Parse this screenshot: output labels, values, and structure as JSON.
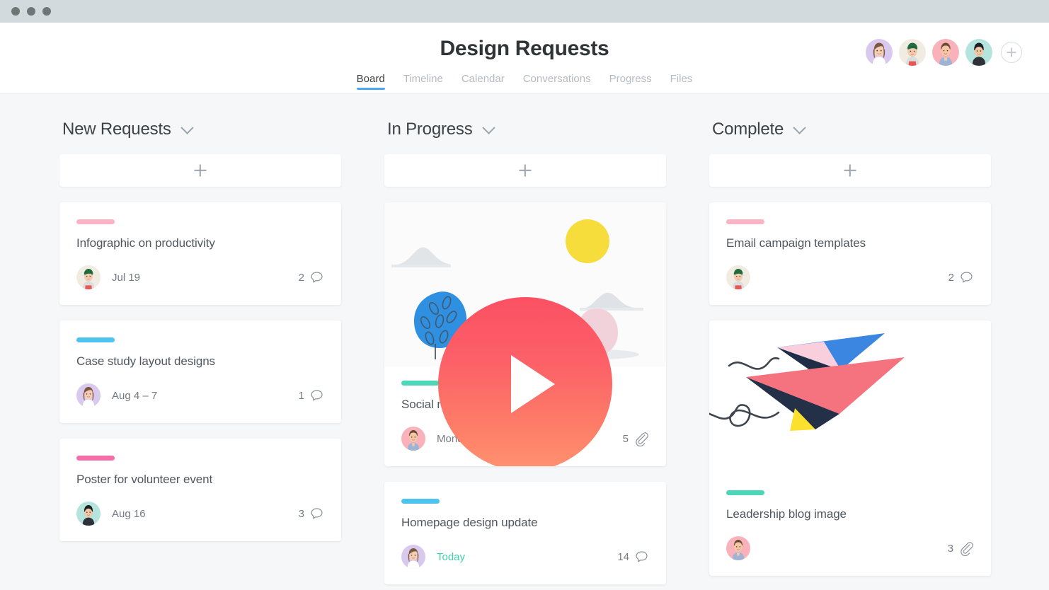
{
  "window": {
    "dots": [
      "close",
      "minimize",
      "maximize"
    ]
  },
  "header": {
    "title": "Design Requests",
    "tabs": [
      {
        "label": "Board",
        "active": true
      },
      {
        "label": "Timeline",
        "active": false
      },
      {
        "label": "Calendar",
        "active": false
      },
      {
        "label": "Conversations",
        "active": false
      },
      {
        "label": "Progress",
        "active": false
      },
      {
        "label": "Files",
        "active": false
      }
    ],
    "members": [
      {
        "name": "member-1",
        "bg": "#d9c9ef"
      },
      {
        "name": "member-2",
        "bg": "#f0ece2"
      },
      {
        "name": "member-3",
        "bg": "#f9b2ba"
      },
      {
        "name": "member-4",
        "bg": "#b5e3dd"
      }
    ],
    "add_member_icon": "plus-icon"
  },
  "colors": {
    "tag_light_pink": "#fab4c4",
    "tag_blue": "#4ec3f0",
    "tag_hot_pink": "#f56ea8",
    "tag_teal": "#4ed6b8",
    "accent_blue": "#4aa8f0",
    "today_green": "#3ecfab",
    "board_bg": "#f6f7f9",
    "titlebar_bg": "#d3dadd"
  },
  "board": {
    "columns": [
      {
        "title": "New Requests",
        "add_label": "add-card",
        "cards": [
          {
            "tag_color": "#fab4c4",
            "title": "Infographic on productivity",
            "date": "Jul 19",
            "date_highlight": false,
            "avatar_bg": "#f0ece2",
            "avatar_kind": "member-2",
            "meta_count": "2",
            "meta_icon": "comment-icon"
          },
          {
            "tag_color": "#4ec3f0",
            "title": "Case study layout designs",
            "date": "Aug 4 – 7",
            "date_highlight": false,
            "avatar_bg": "#d9c9ef",
            "avatar_kind": "member-1",
            "meta_count": "1",
            "meta_icon": "comment-icon"
          },
          {
            "tag_color": "#f56ea8",
            "title": "Poster for volunteer event",
            "date": "Aug 16",
            "date_highlight": false,
            "avatar_bg": "#b5e3dd",
            "avatar_kind": "member-4",
            "meta_count": "3",
            "meta_icon": "comment-icon"
          }
        ]
      },
      {
        "title": "In Progress",
        "add_label": "add-card",
        "cards": [
          {
            "tag_color": "#4ed6b8",
            "title": "Social media assets",
            "date": "Monday",
            "date_highlight": false,
            "avatar_bg": "#f9b2ba",
            "avatar_kind": "member-3",
            "meta_count": "5",
            "meta_icon": "attachment-icon",
            "media": "video-thumbnail-landscape",
            "play_button": "play-icon"
          },
          {
            "tag_color": "#4ec3f0",
            "title": "Homepage design update",
            "date": "Today",
            "date_highlight": true,
            "avatar_bg": "#d9c9ef",
            "avatar_kind": "member-1",
            "meta_count": "14",
            "meta_icon": "comment-icon"
          }
        ]
      },
      {
        "title": "Complete",
        "add_label": "add-card",
        "cards": [
          {
            "tag_color": "#fab4c4",
            "title": "Email campaign templates",
            "date": "",
            "date_highlight": false,
            "avatar_bg": "#f0ece2",
            "avatar_kind": "member-2",
            "meta_count": "2",
            "meta_icon": "comment-icon"
          },
          {
            "tag_color": "#4ed6b8",
            "title": "Leadership blog image",
            "date": "",
            "date_highlight": false,
            "avatar_bg": "#f9b2ba",
            "avatar_kind": "member-3",
            "meta_count": "3",
            "meta_icon": "attachment-icon",
            "media": "paper-airplanes-illustration"
          }
        ]
      }
    ]
  }
}
